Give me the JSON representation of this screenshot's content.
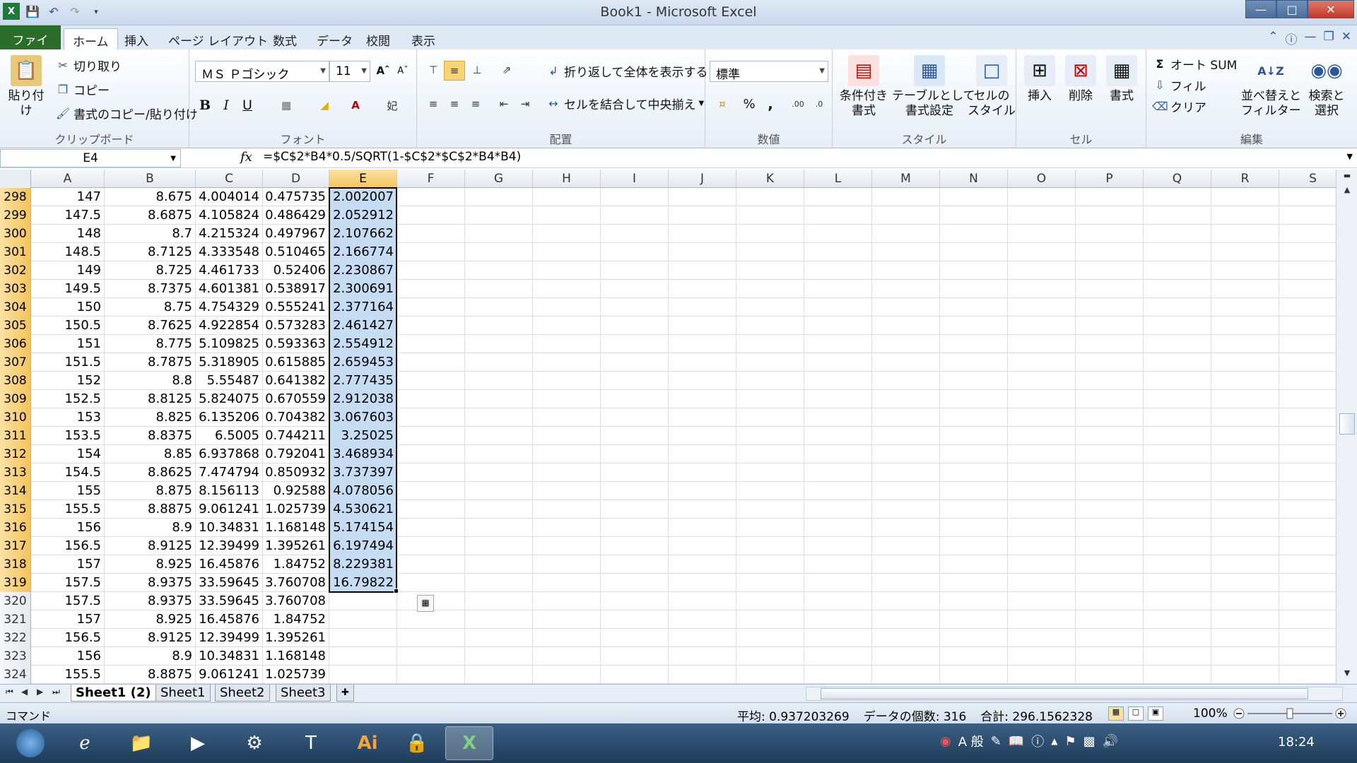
{
  "window": {
    "title": "Book1 - Microsoft Excel"
  },
  "tabs": [
    "ファイル",
    "ホーム",
    "挿入",
    "ページ レイアウト",
    "数式",
    "データ",
    "校閲",
    "表示"
  ],
  "ribbon": {
    "clipboard": {
      "paste": "貼り付け",
      "cut": "切り取り",
      "copy": "コピー",
      "format_painter": "書式のコピー/貼り付け",
      "label": "クリップボード"
    },
    "font": {
      "name": "ＭＳ Ｐゴシック",
      "size": "11",
      "bold": "B",
      "italic": "I",
      "underline": "U",
      "label": "フォント"
    },
    "alignment": {
      "wrap": "折り返して全体を表示する",
      "merge": "セルを結合して中央揃え",
      "label": "配置"
    },
    "number": {
      "format": "標準",
      "percent": "%",
      "comma": ",",
      "label": "数値"
    },
    "styles": {
      "conditional": "条件付き\n書式",
      "table": "テーブルとして\n書式設定",
      "cell": "セルの\nスタイル",
      "label": "スタイル"
    },
    "cells": {
      "insert": "挿入",
      "delete": "削除",
      "format": "書式",
      "label": "セル"
    },
    "editing": {
      "autosum": "オート SUM",
      "fill": "フィル",
      "clear": "クリア",
      "sort": "並べ替えと\nフィルター",
      "find": "検索と\n選択",
      "label": "編集"
    }
  },
  "formula_bar": {
    "name_box": "E4",
    "fx": "fx",
    "formula": "=$C$2*B4*0.5/SQRT(1-$C$2*$C$2*B4*B4)"
  },
  "columns": [
    "A",
    "B",
    "C",
    "D",
    "E",
    "F",
    "G",
    "H",
    "I",
    "J",
    "K",
    "L",
    "M",
    "N",
    "O",
    "P",
    "Q",
    "R",
    "S"
  ],
  "selected_column": "E",
  "rows": [
    {
      "num": "298",
      "a": "147",
      "b": "8.675",
      "c": "4.004014",
      "d": "0.475735",
      "e": "2.002007",
      "sel": true
    },
    {
      "num": "299",
      "a": "147.5",
      "b": "8.6875",
      "c": "4.105824",
      "d": "0.486429",
      "e": "2.052912",
      "sel": true
    },
    {
      "num": "300",
      "a": "148",
      "b": "8.7",
      "c": "4.215324",
      "d": "0.497967",
      "e": "2.107662",
      "sel": true
    },
    {
      "num": "301",
      "a": "148.5",
      "b": "8.7125",
      "c": "4.333548",
      "d": "0.510465",
      "e": "2.166774",
      "sel": true
    },
    {
      "num": "302",
      "a": "149",
      "b": "8.725",
      "c": "4.461733",
      "d": "0.52406",
      "e": "2.230867",
      "sel": true
    },
    {
      "num": "303",
      "a": "149.5",
      "b": "8.7375",
      "c": "4.601381",
      "d": "0.538917",
      "e": "2.300691",
      "sel": true
    },
    {
      "num": "304",
      "a": "150",
      "b": "8.75",
      "c": "4.754329",
      "d": "0.555241",
      "e": "2.377164",
      "sel": true
    },
    {
      "num": "305",
      "a": "150.5",
      "b": "8.7625",
      "c": "4.922854",
      "d": "0.573283",
      "e": "2.461427",
      "sel": true
    },
    {
      "num": "306",
      "a": "151",
      "b": "8.775",
      "c": "5.109825",
      "d": "0.593363",
      "e": "2.554912",
      "sel": true
    },
    {
      "num": "307",
      "a": "151.5",
      "b": "8.7875",
      "c": "5.318905",
      "d": "0.615885",
      "e": "2.659453",
      "sel": true
    },
    {
      "num": "308",
      "a": "152",
      "b": "8.8",
      "c": "5.55487",
      "d": "0.641382",
      "e": "2.777435",
      "sel": true
    },
    {
      "num": "309",
      "a": "152.5",
      "b": "8.8125",
      "c": "5.824075",
      "d": "0.670559",
      "e": "2.912038",
      "sel": true
    },
    {
      "num": "310",
      "a": "153",
      "b": "8.825",
      "c": "6.135206",
      "d": "0.704382",
      "e": "3.067603",
      "sel": true
    },
    {
      "num": "311",
      "a": "153.5",
      "b": "8.8375",
      "c": "6.5005",
      "d": "0.744211",
      "e": "3.25025",
      "sel": true
    },
    {
      "num": "312",
      "a": "154",
      "b": "8.85",
      "c": "6.937868",
      "d": "0.792041",
      "e": "3.468934",
      "sel": true
    },
    {
      "num": "313",
      "a": "154.5",
      "b": "8.8625",
      "c": "7.474794",
      "d": "0.850932",
      "e": "3.737397",
      "sel": true
    },
    {
      "num": "314",
      "a": "155",
      "b": "8.875",
      "c": "8.156113",
      "d": "0.92588",
      "e": "4.078056",
      "sel": true
    },
    {
      "num": "315",
      "a": "155.5",
      "b": "8.8875",
      "c": "9.061241",
      "d": "1.025739",
      "e": "4.530621",
      "sel": true
    },
    {
      "num": "316",
      "a": "156",
      "b": "8.9",
      "c": "10.34831",
      "d": "1.168148",
      "e": "5.174154",
      "sel": true
    },
    {
      "num": "317",
      "a": "156.5",
      "b": "8.9125",
      "c": "12.39499",
      "d": "1.395261",
      "e": "6.197494",
      "sel": true
    },
    {
      "num": "318",
      "a": "157",
      "b": "8.925",
      "c": "16.45876",
      "d": "1.84752",
      "e": "8.229381",
      "sel": true
    },
    {
      "num": "319",
      "a": "157.5",
      "b": "8.9375",
      "c": "33.59645",
      "d": "3.760708",
      "e": "16.79822",
      "sel": true
    },
    {
      "num": "320",
      "a": "157.5",
      "b": "8.9375",
      "c": "33.59645",
      "d": "3.760708",
      "e": "",
      "sel": false
    },
    {
      "num": "321",
      "a": "157",
      "b": "8.925",
      "c": "16.45876",
      "d": "1.84752",
      "e": "",
      "sel": false
    },
    {
      "num": "322",
      "a": "156.5",
      "b": "8.9125",
      "c": "12.39499",
      "d": "1.395261",
      "e": "",
      "sel": false
    },
    {
      "num": "323",
      "a": "156",
      "b": "8.9",
      "c": "10.34831",
      "d": "1.168148",
      "e": "",
      "sel": false
    },
    {
      "num": "324",
      "a": "155.5",
      "b": "8.8875",
      "c": "9.061241",
      "d": "1.025739",
      "e": "",
      "sel": false
    }
  ],
  "sheets": [
    "Sheet1 (2)",
    "Sheet1",
    "Sheet2",
    "Sheet3"
  ],
  "active_sheet": "Sheet1 (2)",
  "status": {
    "mode": "コマンド",
    "average": "平均: 0.937203269",
    "count": "データの個数: 316",
    "sum": "合計: 296.1562328",
    "zoom": "100%"
  },
  "taskbar": {
    "clock": "18:24",
    "ime": "A 般"
  },
  "colors": {
    "accent": "#2b579a",
    "file_tab": "#2a6e2a",
    "selection": "#c6dcf2",
    "header_sel": "#f4c35b"
  }
}
